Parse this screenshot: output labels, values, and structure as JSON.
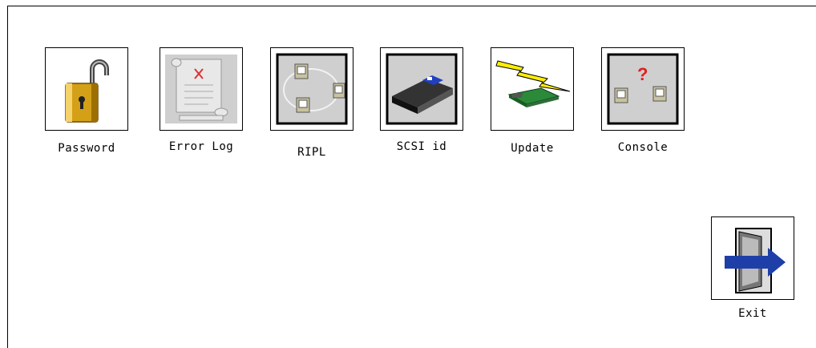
{
  "tools": [
    {
      "id": "password",
      "label": "Password",
      "icon": "padlock-icon"
    },
    {
      "id": "error-log",
      "label": "Error Log",
      "icon": "error-scroll-icon"
    },
    {
      "id": "ripl",
      "label": "RIPL",
      "icon": "network-computers-icon"
    },
    {
      "id": "scsi-id",
      "label": "SCSI id",
      "icon": "scsi-drive-icon"
    },
    {
      "id": "update",
      "label": "Update",
      "icon": "firmware-update-icon"
    },
    {
      "id": "console",
      "label": "Console",
      "icon": "console-question-icon"
    }
  ],
  "exit": {
    "label": "Exit",
    "icon": "exit-door-arrow-icon"
  }
}
